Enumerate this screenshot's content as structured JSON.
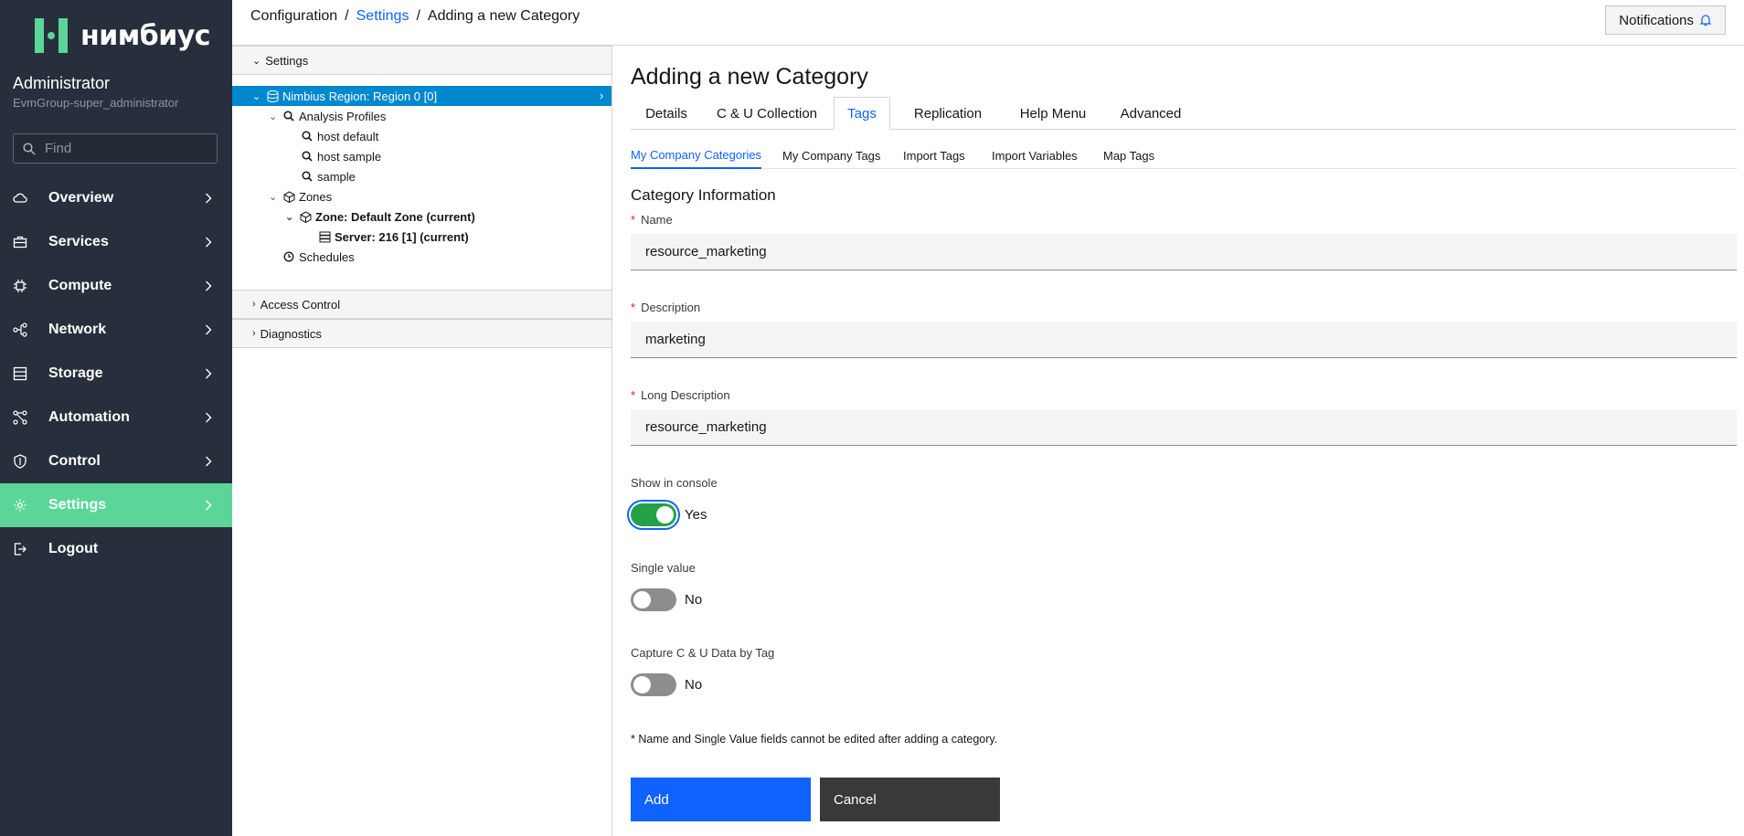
{
  "brand": {
    "name": "нимбиус",
    "accent": "#5bd698"
  },
  "user": {
    "name": "Administrator",
    "group": "EvmGroup-super_administrator"
  },
  "nav": {
    "search_placeholder": "Find",
    "items": [
      {
        "label": "Overview",
        "icon": "cloud-icon"
      },
      {
        "label": "Services",
        "icon": "briefcase-icon"
      },
      {
        "label": "Compute",
        "icon": "chip-icon"
      },
      {
        "label": "Network",
        "icon": "network-icon"
      },
      {
        "label": "Storage",
        "icon": "storage-icon"
      },
      {
        "label": "Automation",
        "icon": "automation-icon"
      },
      {
        "label": "Control",
        "icon": "shield-icon"
      },
      {
        "label": "Settings",
        "icon": "gear-icon",
        "active": true
      },
      {
        "label": "Logout",
        "icon": "logout-icon"
      }
    ]
  },
  "breadcrumb": {
    "root": "Configuration",
    "link": "Settings",
    "current": "Adding a new Category",
    "separator": "/"
  },
  "notifications": {
    "label": "Notifications"
  },
  "tree": {
    "settings_header": "Settings",
    "region": "Nimbius Region: Region 0 [0]",
    "analysis_profiles": "Analysis Profiles",
    "profiles": [
      "host default",
      "host sample",
      "sample"
    ],
    "zones": "Zones",
    "zone": "Zone: Default Zone (current)",
    "server": "Server: 216 [1] (current)",
    "schedules": "Schedules",
    "access_control": "Access Control",
    "diagnostics": "Diagnostics"
  },
  "page": {
    "title": "Adding a new Category",
    "tabs": [
      "Details",
      "C & U Collection",
      "Tags",
      "Replication",
      "Help Menu",
      "Advanced"
    ],
    "active_tab": "Tags",
    "subtabs": [
      "My Company Categories",
      "My Company Tags",
      "Import Tags",
      "Import Variables",
      "Map Tags"
    ],
    "active_subtab": "My Company Categories",
    "section_title": "Category Information",
    "required_mark": "*",
    "fields": {
      "name": {
        "label": "Name",
        "value": "resource_marketing"
      },
      "description": {
        "label": "Description",
        "value": "marketing"
      },
      "long_description": {
        "label": "Long Description",
        "value": "resource_marketing"
      }
    },
    "toggles": {
      "show_in_console": {
        "label": "Show in console",
        "state": "Yes",
        "on": true
      },
      "single_value": {
        "label": "Single value",
        "state": "No",
        "on": false
      },
      "capture_cu": {
        "label": "Capture C & U Data by Tag",
        "state": "No",
        "on": false
      }
    },
    "footnote": "* Name and Single Value fields cannot be edited after adding a category.",
    "buttons": {
      "add": "Add",
      "cancel": "Cancel"
    }
  }
}
